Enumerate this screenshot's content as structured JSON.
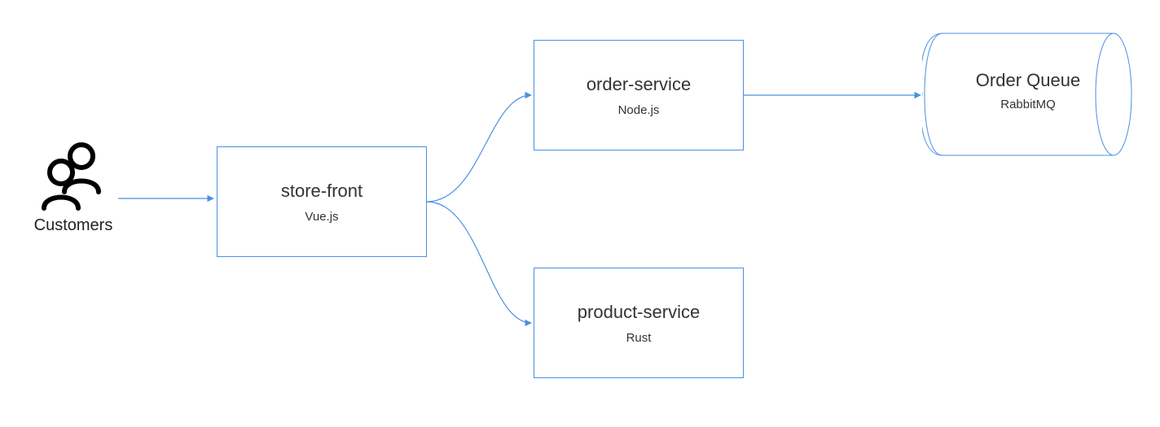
{
  "actor": {
    "label": "Customers"
  },
  "nodes": {
    "store_front": {
      "title": "store-front",
      "subtitle": "Vue.js"
    },
    "order_service": {
      "title": "order-service",
      "subtitle": "Node.js"
    },
    "product_service": {
      "title": "product-service",
      "subtitle": "Rust"
    },
    "order_queue": {
      "title": "Order Queue",
      "subtitle": "RabbitMQ"
    }
  },
  "edges": [
    {
      "from": "customers",
      "to": "store-front"
    },
    {
      "from": "store-front",
      "to": "order-service"
    },
    {
      "from": "store-front",
      "to": "product-service"
    },
    {
      "from": "order-service",
      "to": "order-queue"
    }
  ],
  "colors": {
    "stroke": "#4a90e2",
    "actor_stroke": "#000000"
  }
}
